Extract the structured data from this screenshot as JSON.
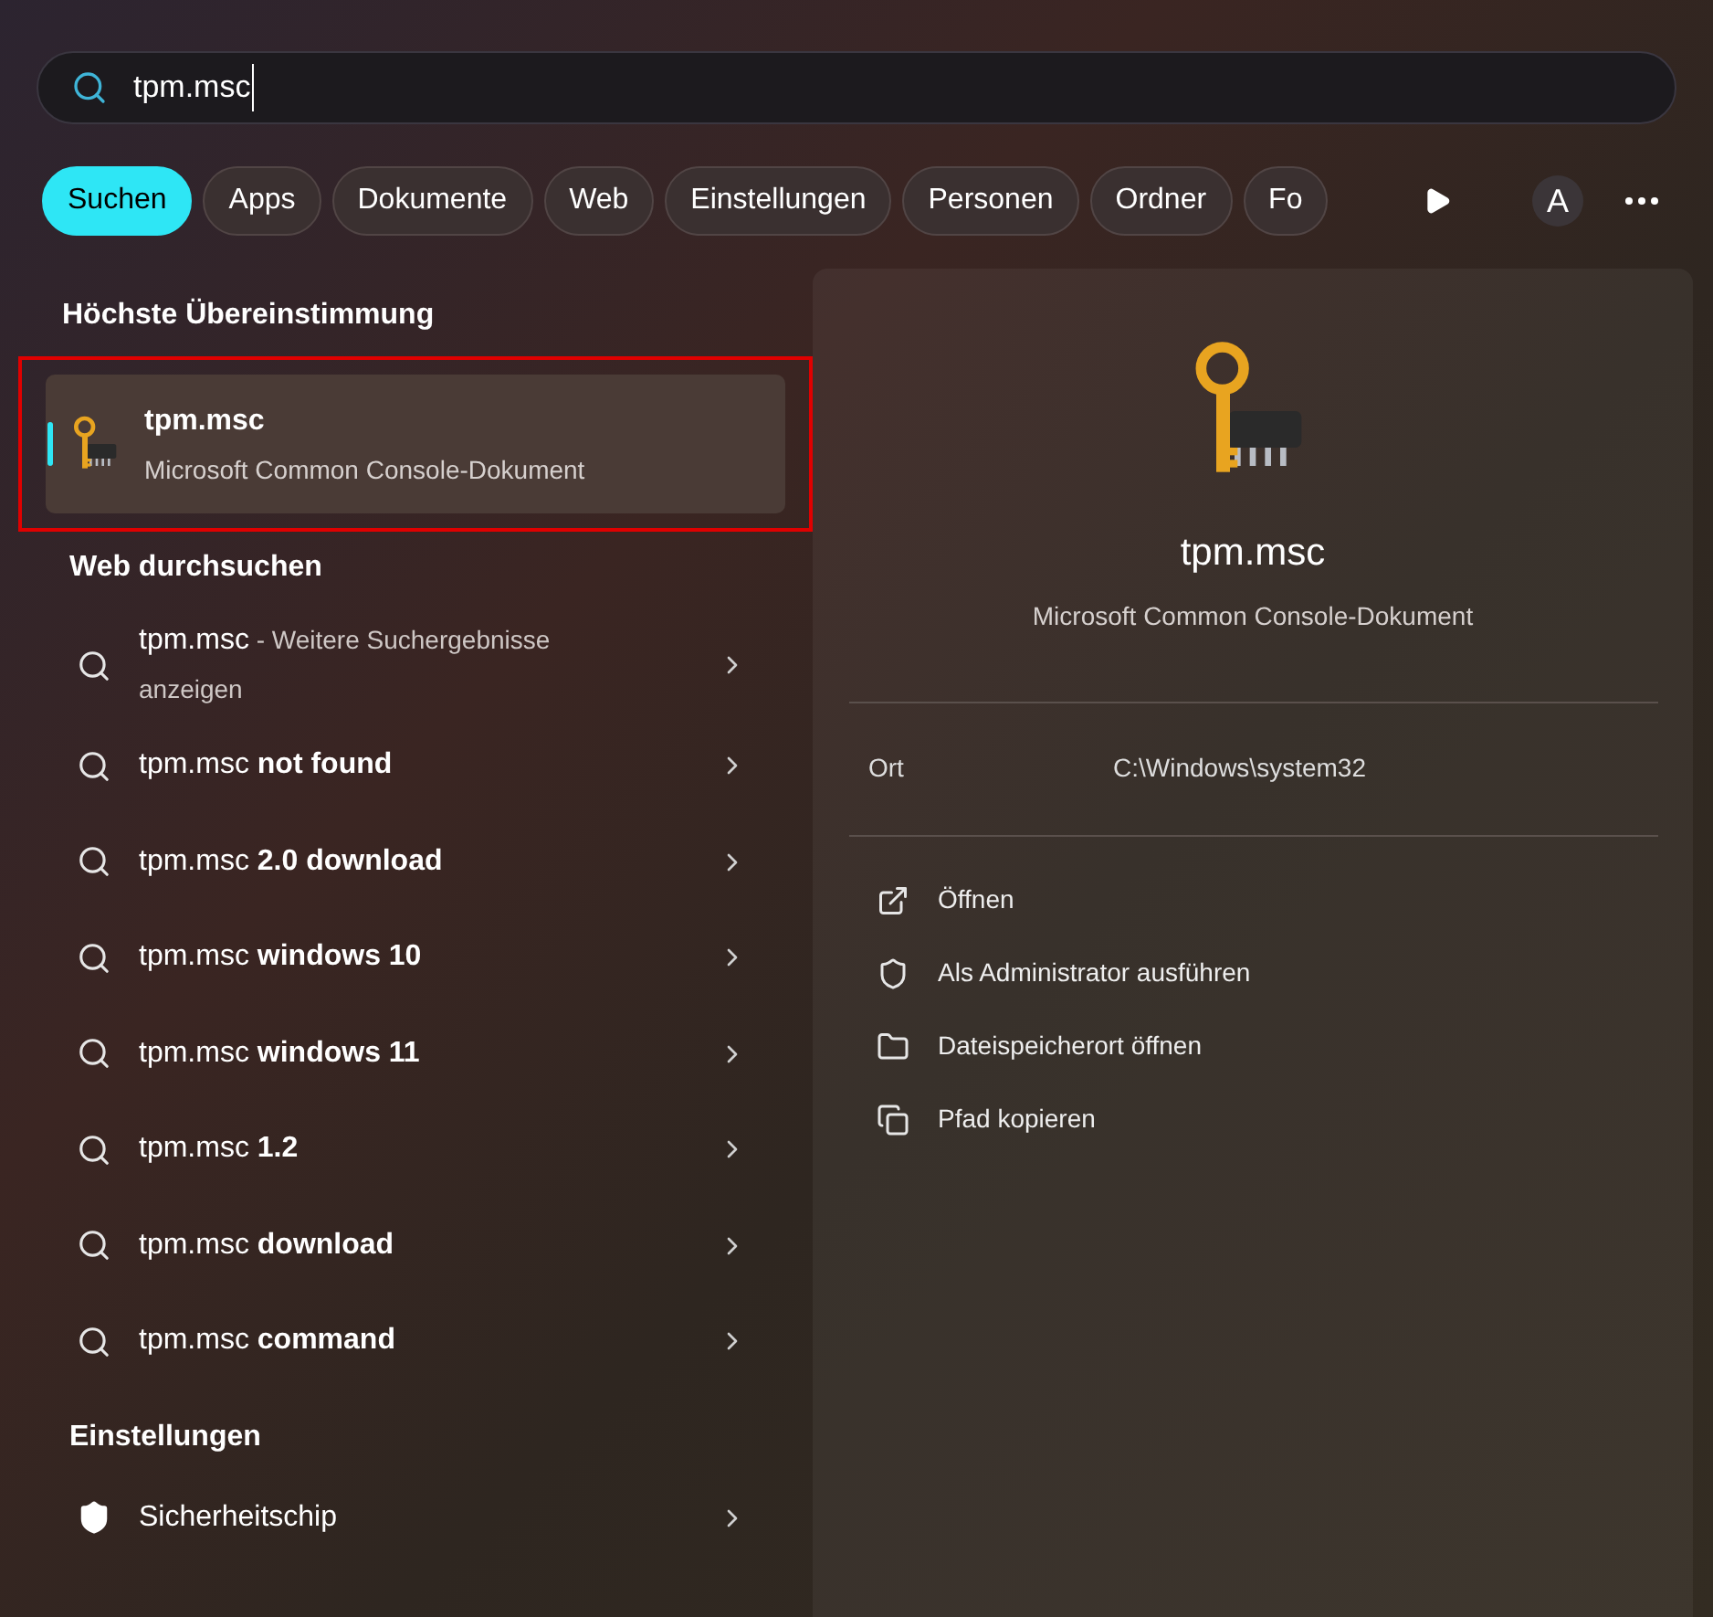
{
  "search": {
    "value": "tpm.msc"
  },
  "filters": [
    {
      "label": "Suchen",
      "selected": true
    },
    {
      "label": "Apps",
      "selected": false
    },
    {
      "label": "Dokumente",
      "selected": false
    },
    {
      "label": "Web",
      "selected": false
    },
    {
      "label": "Einstellungen",
      "selected": false
    },
    {
      "label": "Personen",
      "selected": false
    },
    {
      "label": "Ordner",
      "selected": false
    },
    {
      "label": "Fo",
      "selected": false
    }
  ],
  "account": {
    "initial": "A"
  },
  "top_match": {
    "heading": "Höchste Übereinstimmung",
    "title": "tpm.msc",
    "subtitle": "Microsoft Common Console-Dokument",
    "selected": true,
    "highlighted": true
  },
  "web": {
    "heading": "Web durchsuchen",
    "items": [
      {
        "kind": "more",
        "query": "tpm.msc",
        "detail": " - Weitere Suchergebnisse anzeigen"
      },
      {
        "kind": "suggestion",
        "query": "tpm.msc",
        "detail": "not found"
      },
      {
        "kind": "suggestion",
        "query": "tpm.msc",
        "detail": "2.0 download"
      },
      {
        "kind": "suggestion",
        "query": "tpm.msc",
        "detail": "windows 10"
      },
      {
        "kind": "suggestion",
        "query": "tpm.msc",
        "detail": "windows 11"
      },
      {
        "kind": "suggestion",
        "query": "tpm.msc",
        "detail": "1.2"
      },
      {
        "kind": "suggestion",
        "query": "tpm.msc",
        "detail": "download"
      },
      {
        "kind": "suggestion",
        "query": "tpm.msc",
        "detail": "command"
      }
    ]
  },
  "settings": {
    "heading": "Einstellungen",
    "items": [
      {
        "label": "Sicherheitschip"
      }
    ]
  },
  "preview": {
    "title": "tpm.msc",
    "subtitle": "Microsoft Common Console-Dokument",
    "details": [
      {
        "label": "Ort",
        "value": "C:\\Windows\\system32"
      }
    ],
    "actions": [
      {
        "kind": "open",
        "label": "Öffnen"
      },
      {
        "kind": "admin",
        "label": "Als Administrator ausführen"
      },
      {
        "kind": "folder",
        "label": "Dateispeicherort öffnen"
      },
      {
        "kind": "copy",
        "label": "Pfad kopieren"
      }
    ]
  }
}
